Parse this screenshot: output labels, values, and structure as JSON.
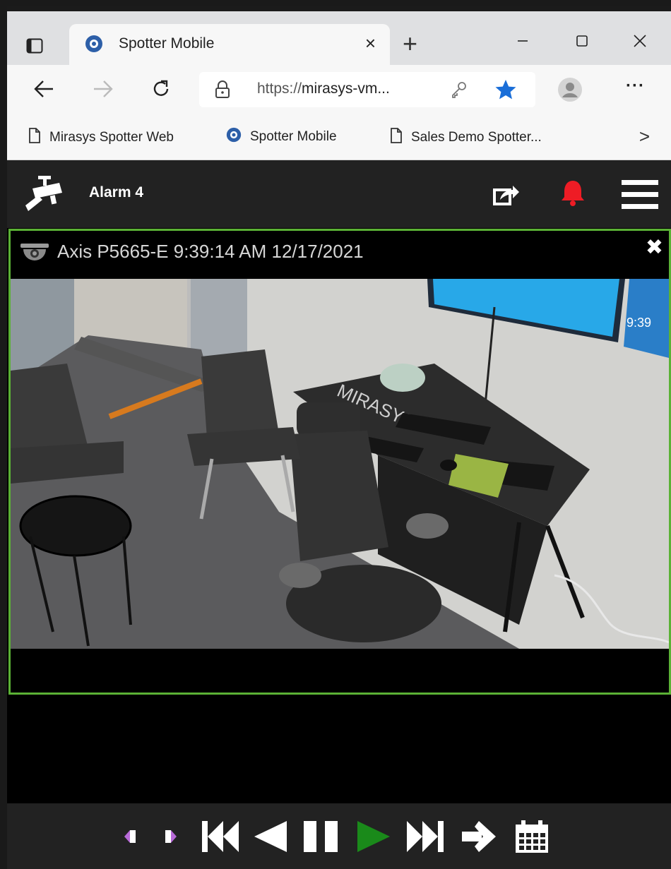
{
  "browser": {
    "tab_title": "Spotter Mobile",
    "tab_close": "×",
    "new_tab": "+",
    "url_scheme": "https://",
    "url_host": "mirasys-vm...",
    "more": "···",
    "bookmarks": [
      {
        "label": "Mirasys Spotter Web",
        "icon": "page-icon"
      },
      {
        "label": "Spotter Mobile",
        "icon": "spotter-favicon-icon"
      },
      {
        "label": "Sales Demo Spotter...",
        "icon": "page-icon"
      }
    ],
    "bookmarks_chevron": ">"
  },
  "app": {
    "header_title": "Alarm 4",
    "accent_color": "#5bb135",
    "alert_color": "#ee1c25"
  },
  "camera": {
    "title": "Axis P5665-E 9:39:14 AM 12/17/2021",
    "close": "✖",
    "icon": "dome-camera-icon",
    "video_overlay_text": "MIRASYS",
    "screen_clock": "9:39"
  },
  "playback": {
    "controls": [
      "step-back",
      "step-forward",
      "rewind-fast",
      "play-backward",
      "pause",
      "play",
      "fast-forward",
      "go-to-live",
      "calendar"
    ],
    "play_color": "#1a8a1a"
  }
}
